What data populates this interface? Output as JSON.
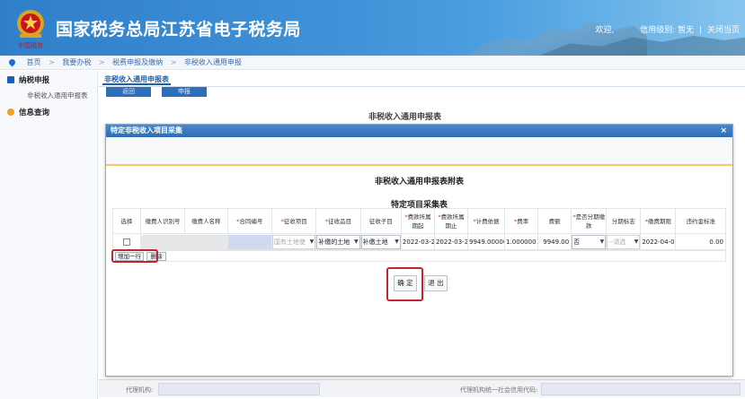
{
  "header": {
    "title": "国家税务总局江苏省电子税务局",
    "emblem_text": "中国税务",
    "welcome": "欢迎,",
    "credit": "信用级别: 暂无",
    "separator": "|",
    "close": "关闭当页"
  },
  "breadcrumb": {
    "items": [
      "首页",
      "我要办税",
      "税费申报及缴纳",
      "非税收入通用申报"
    ],
    "separator": ">"
  },
  "sidebar": {
    "groups": [
      {
        "label": "纳税申报",
        "icon": "tax-report-icon",
        "color": "#1d5fb6"
      },
      {
        "label": "信息查询",
        "icon": "info-query-icon",
        "color": "#f0a020"
      }
    ],
    "sub_items": [
      "非税收入通用申报表"
    ]
  },
  "content": {
    "tab": "非税收入通用申报表",
    "back_button": "返回",
    "declare_button": "申报",
    "page_title": "非税收入通用申报表",
    "bottom_fields": {
      "agency_label": "代理机构:",
      "agency_credit_label": "代理机构统一社会信用代码:"
    }
  },
  "modal": {
    "title": "特定非税收入项目采集",
    "close": "×",
    "attachment_title": "非税收入通用申报表附表",
    "table_title": "特定项目采集表",
    "columns": [
      {
        "label": "选择",
        "required": false
      },
      {
        "label": "缴费人识别号",
        "required": false
      },
      {
        "label": "缴费人名称",
        "required": false
      },
      {
        "label": "合同编号",
        "required": true
      },
      {
        "label": "征收项目",
        "required": true
      },
      {
        "label": "征收品目",
        "required": true
      },
      {
        "label": "征收子目",
        "required": false
      },
      {
        "label": "费款所属期起",
        "required": true
      },
      {
        "label": "费款所属期止",
        "required": true
      },
      {
        "label": "计费依据",
        "required": true
      },
      {
        "label": "费率",
        "required": true
      },
      {
        "label": "费额",
        "required": false
      },
      {
        "label": "是否分期缴款",
        "required": true
      },
      {
        "label": "分期标志",
        "required": false
      },
      {
        "label": "缴费期限",
        "required": true
      },
      {
        "label": "违约金标准",
        "required": false
      }
    ],
    "row": {
      "taxpayer_id": "",
      "taxpayer_name": "",
      "contract_no": "",
      "levy_item": "国有土地使",
      "levy_category": "补缴的土地",
      "levy_subcategory": "补缴土地",
      "period_start": "2022-03-2",
      "period_end": "2022-03-2",
      "basis": "9949.00000",
      "rate": "1.000000",
      "amount": "9949.00",
      "installment": "否",
      "installment_flag": "--请选",
      "deadline": "2022-04-0",
      "penalty": "0.00"
    },
    "add_row_button": "增加一行",
    "delete_button": "删除",
    "confirm_button": "确 定",
    "exit_button": "退 出"
  },
  "colors": {
    "accent": "#2e6db3",
    "highlight": "#c0262d",
    "required": "#e0312f"
  }
}
